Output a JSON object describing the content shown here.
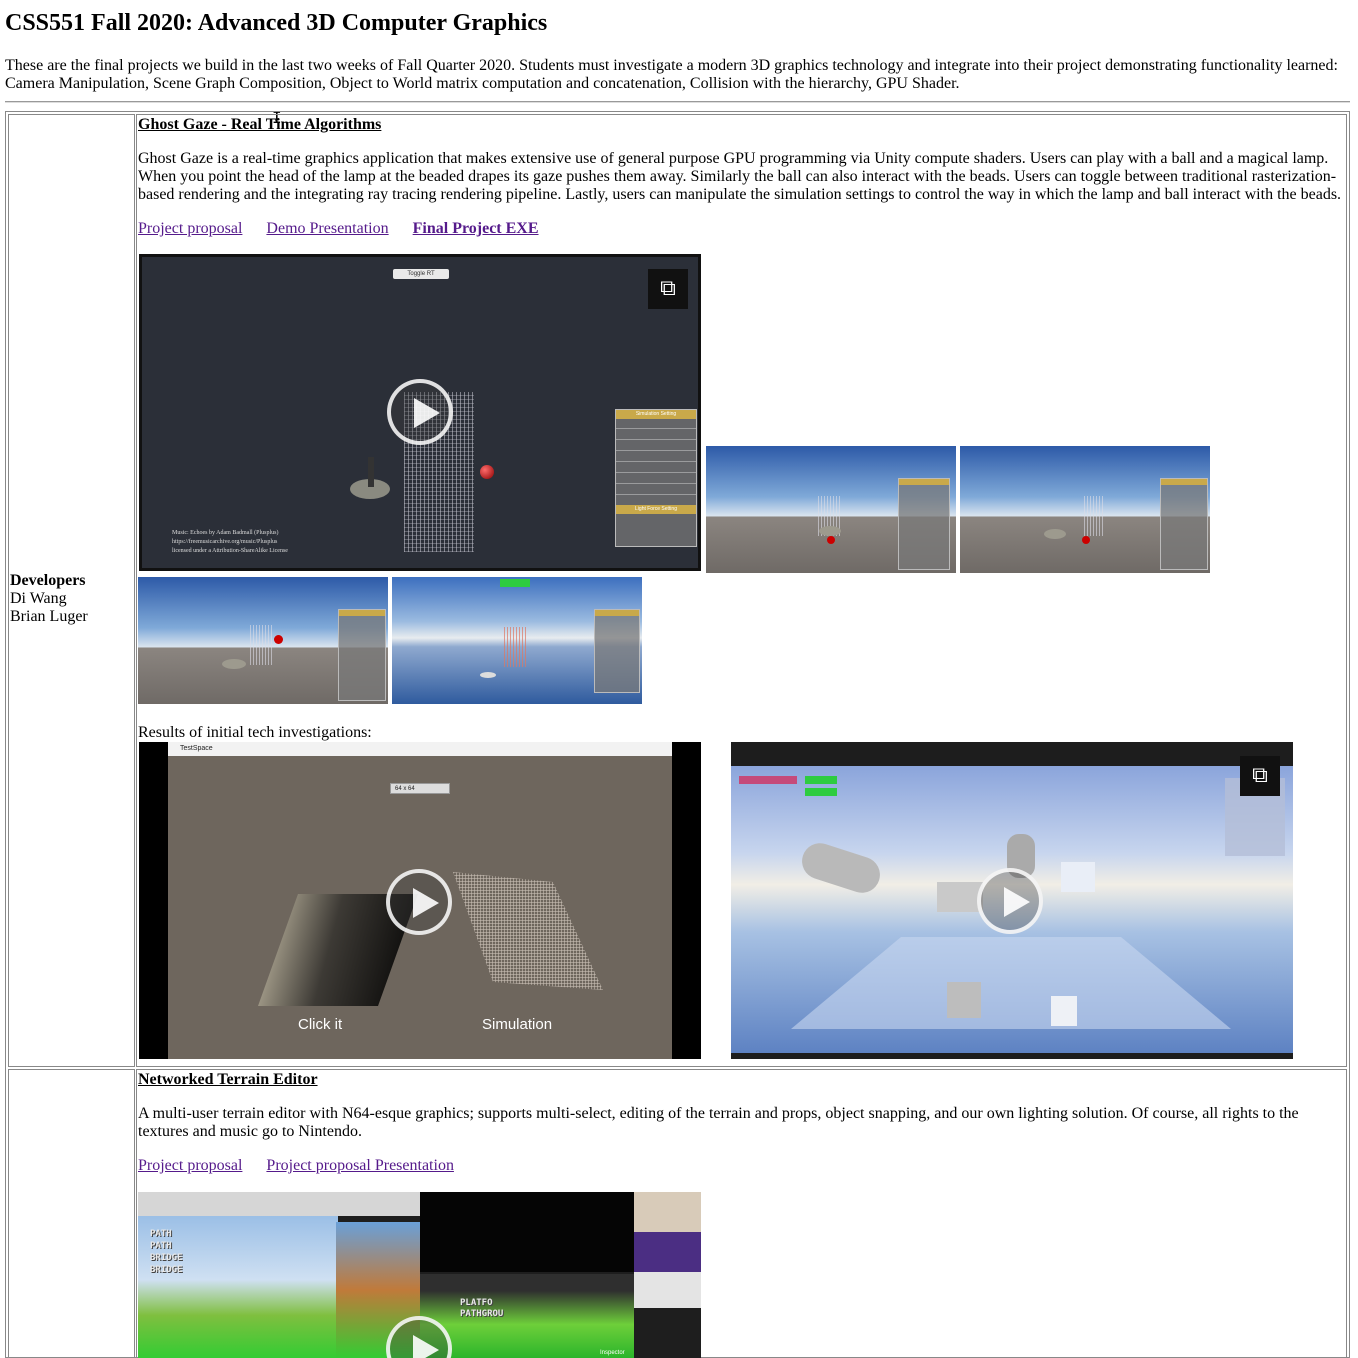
{
  "page": {
    "title": "CSS551 Fall 2020: Advanced 3D Computer Graphics",
    "intro": "These are the final projects we build in the last two weeks of Fall Quarter 2020. Students must investigate a modern 3D graphics technology and integrate into their project demonstrating functionality learned: Camera Manipulation, Scene Graph Composition, Object to World matrix computation and concatenation, Collision with the hierarchy, GPU Shader."
  },
  "projects": [
    {
      "developers_heading": "Developers",
      "developers": [
        "Di Wang",
        "Brian Luger"
      ],
      "title": "Ghost Gaze - Real Time Algorithms",
      "description": "Ghost Gaze is a real-time graphics application that makes extensive use of general purpose GPU programming via Unity compute shaders. Users can play with a ball and a magical lamp. When you point the head of the lamp at the beaded drapes its gaze pushes them away. Similarly the ball can also interact with the beads. Users can toggle between traditional rasterization-based rendering and the integrating ray tracing rendering pipeline. Lastly, users can manipulate the simulation settings to control the way in which the lamp and ball interact with the beads.",
      "links": [
        "Project proposal",
        "Demo Presentation",
        "Final Project EXE"
      ],
      "video_overlay": {
        "toggle_label": "Toggle RT",
        "credits": [
          "Music: Echoes by Adam Badmall (Plusplus)",
          "https://freemusicarchive.org/music/Plusplus",
          "licensed under a Attribution-ShareAlike License"
        ],
        "panel_heading_1": "Simulation Setting",
        "panel_heading_2": "Light Force Setting"
      },
      "investigations_caption": "Results of initial tech investigations:",
      "investigation_video_1": {
        "window_title": "TestSpace",
        "dropdown": "64 x 64",
        "label_left": "Click it",
        "label_right": "Simulation"
      }
    },
    {
      "title": "Networked Terrain Editor",
      "description": "A multi-user terrain editor with N64-esque graphics; supports multi-select, editing of the terrain and props, object snapping, and our own lighting solution. Of course, all rights to the textures and music go to Nintendo.",
      "links": [
        "Project proposal",
        "Project proposal Presentation"
      ],
      "thumb_labels": [
        "PATH",
        "PATH",
        "BRIDGE",
        "BRIDGE",
        "PLATFO",
        "PATHGROU",
        "Inspector"
      ]
    }
  ],
  "icons": {
    "play": "play-icon",
    "external": "external-link-icon",
    "external_glyph": "⧉"
  },
  "colors": {
    "visited_link": "#551a8b",
    "border": "#888888",
    "panel_header": "#c9a94a"
  }
}
